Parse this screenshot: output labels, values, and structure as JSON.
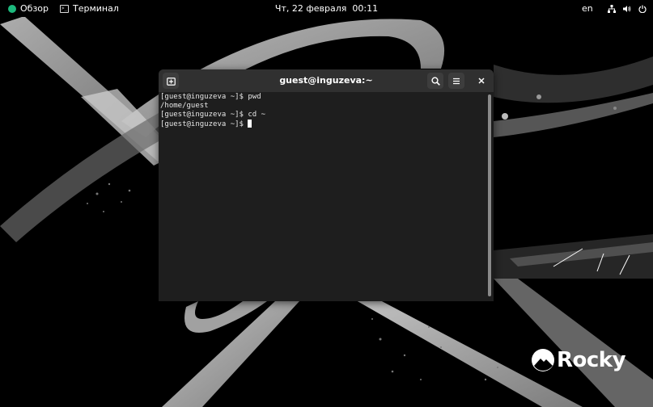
{
  "topbar": {
    "activities_label": "Обзор",
    "app_menu_label": "Терминал",
    "clock": "Чт, 22 февраля  00:11",
    "language": "en",
    "icons": [
      "network-icon",
      "volume-icon",
      "power-icon"
    ]
  },
  "terminal": {
    "title": "guest@inguzeva:~",
    "lines": [
      "[guest@inguzeva ~]$ pwd",
      "/home/guest",
      "[guest@inguzeva ~]$ cd ~",
      "[guest@inguzeva ~]$ "
    ],
    "buttons": {
      "new_tab": "new-tab-icon",
      "search": "search-icon",
      "menu": "hamburger-menu-icon",
      "close": "close-icon"
    }
  },
  "wallpaper": {
    "logo_text": "Rocky",
    "brand_color": "#1db97d"
  }
}
